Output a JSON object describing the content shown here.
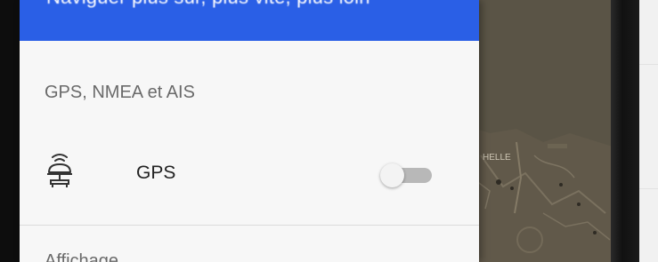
{
  "drawer": {
    "header_text": "Naviguer plus sûr, plus vite, plus loin",
    "header_color": "#2a5fe6",
    "section_title": "GPS, NMEA et AIS",
    "next_section_title": "Affichage",
    "gps_item": {
      "label": "GPS",
      "icon": "gps-antenna-icon",
      "toggle_on": false
    }
  },
  "map": {
    "label_fragment": "HELLE"
  }
}
